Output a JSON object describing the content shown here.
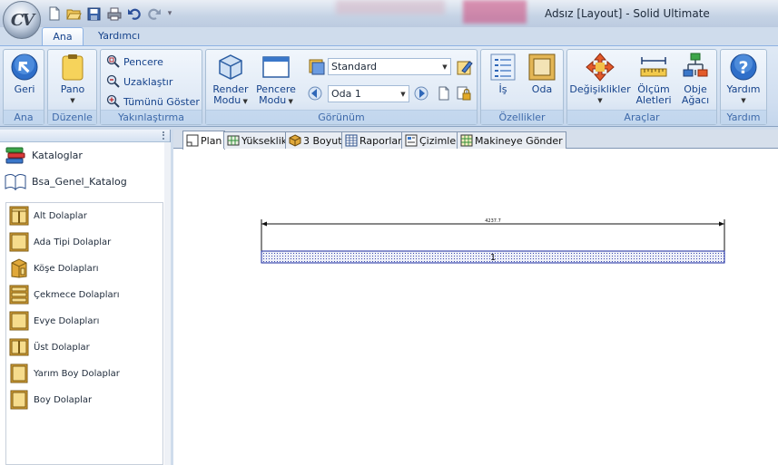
{
  "window": {
    "title": "Adsız [Layout] - Solid Ultimate",
    "app_logo_text": "CV"
  },
  "ribbon_tabs": [
    {
      "label": "Ana",
      "active": true
    },
    {
      "label": "Yardımcı",
      "active": false
    }
  ],
  "groups": {
    "ana": {
      "label": "Ana",
      "back_label": "Geri"
    },
    "duzenle": {
      "label": "Düzenle",
      "pano_label": "Pano"
    },
    "yakinlastirma": {
      "label": "Yakınlaştırma",
      "pencere": "Pencere",
      "uzaklastir": "Uzaklaştır",
      "tumunu_goster": "Tümünü Göster"
    },
    "gorunum": {
      "label": "Görünüm",
      "render_line1": "Render",
      "render_line2": "Modu",
      "pencere_line1": "Pencere",
      "pencere_line2": "Modu",
      "style_value": "Standard",
      "room_value": "Oda 1"
    },
    "ozellikler": {
      "label": "Özellikler",
      "is_label": "İş",
      "oda_label": "Oda"
    },
    "araclar": {
      "label": "Araçlar",
      "degisiklikler": "Değişiklikler",
      "olcum_line1": "Ölçüm",
      "olcum_line2": "Aletleri",
      "obje_line1": "Obje",
      "obje_line2": "Ağacı"
    },
    "yardim": {
      "label": "Yardım",
      "yardim_label": "Yardım"
    }
  },
  "left_pane": {
    "root_label": "Kataloglar",
    "catalog_label": "Bsa_Genel_Katalog",
    "items": [
      {
        "label": "Alt Dolaplar"
      },
      {
        "label": "Ada Tipi Dolaplar"
      },
      {
        "label": "Köşe Dolapları"
      },
      {
        "label": "Çekmece Dolapları"
      },
      {
        "label": "Evye Dolapları"
      },
      {
        "label": "Üst Dolaplar"
      },
      {
        "label": "Yarım Boy Dolaplar"
      },
      {
        "label": "Boy Dolaplar"
      }
    ]
  },
  "doc_tabs": [
    {
      "label": "Plan",
      "active": true
    },
    {
      "label": "Yükseklik",
      "active": false
    },
    {
      "label": "3 Boyut",
      "active": false
    },
    {
      "label": "Raporlar",
      "active": false
    },
    {
      "label": "Çizimler",
      "active": false
    },
    {
      "label": "Makineye Gönder",
      "active": false
    }
  ],
  "drawing": {
    "dimension_text": "4237.7",
    "wall_label": "1"
  },
  "colors": {
    "accent": "#15428b",
    "ribbon_border": "#8db2e3",
    "catalog_item": "#d8a53b"
  }
}
